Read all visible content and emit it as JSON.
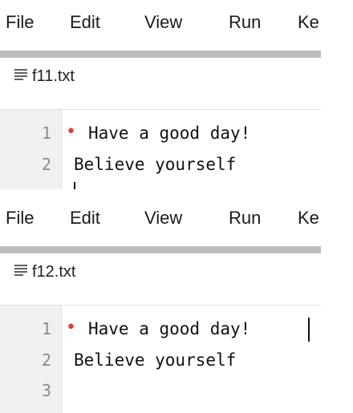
{
  "pane1": {
    "menu": {
      "file": "File",
      "edit": "Edit",
      "view": "View",
      "run": "Run",
      "kernel": "Ke"
    },
    "tab": {
      "filename": "f11.txt"
    },
    "editor": {
      "lines": [
        {
          "number": "1",
          "text": "Have a good day!",
          "modified": true
        },
        {
          "number": "2",
          "text": "Believe yourself",
          "modified": false
        }
      ]
    }
  },
  "pane2": {
    "menu": {
      "file": "File",
      "edit": "Edit",
      "view": "View",
      "run": "Run",
      "kernel": "Ke"
    },
    "tab": {
      "filename": "f12.txt"
    },
    "editor": {
      "lines": [
        {
          "number": "1",
          "text": "Have a good day!",
          "modified": true
        },
        {
          "number": "2",
          "text": "Believe yourself",
          "modified": false
        },
        {
          "number": "3",
          "text": "",
          "modified": false
        }
      ]
    }
  },
  "colors": {
    "modified_marker": "#e53935",
    "gutter": "#f0f0f0",
    "tab_strip": "#bdbdbd"
  },
  "icons": {
    "file_tab": "text-file-icon"
  }
}
